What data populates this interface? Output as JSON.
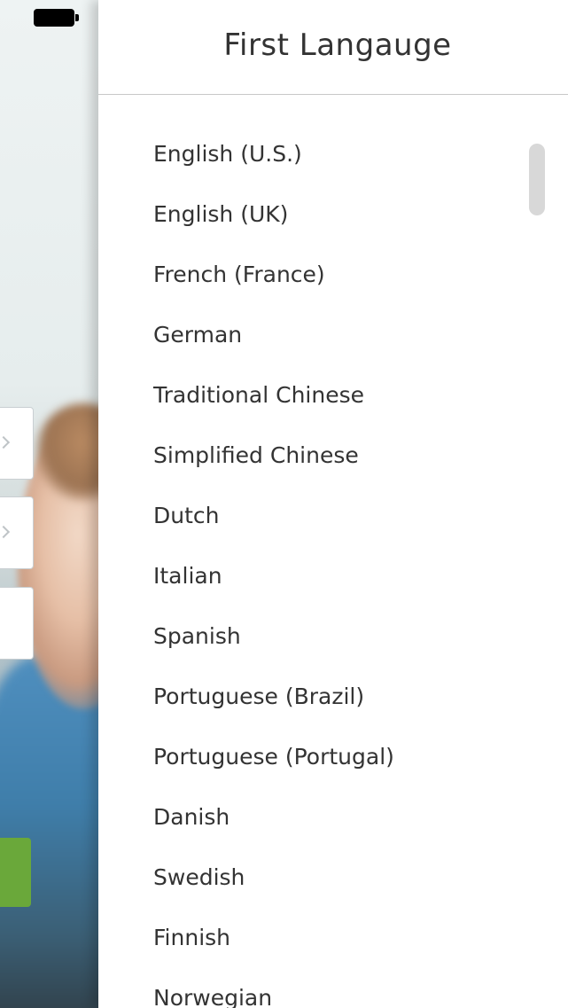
{
  "panel": {
    "title": "First Langauge"
  },
  "languages": [
    "English (U.S.)",
    "English (UK)",
    "French (France)",
    "German",
    "Traditional Chinese",
    "Simplified Chinese",
    "Dutch",
    "Italian",
    "Spanish",
    "Portuguese (Brazil)",
    "Portuguese (Portugal)",
    "Danish",
    "Swedish",
    "Finnish",
    "Norwegian"
  ],
  "background": {
    "accent_green": "#6aa83a"
  },
  "icons": {
    "battery": "battery-icon",
    "chevron": "chevron-right-icon"
  }
}
